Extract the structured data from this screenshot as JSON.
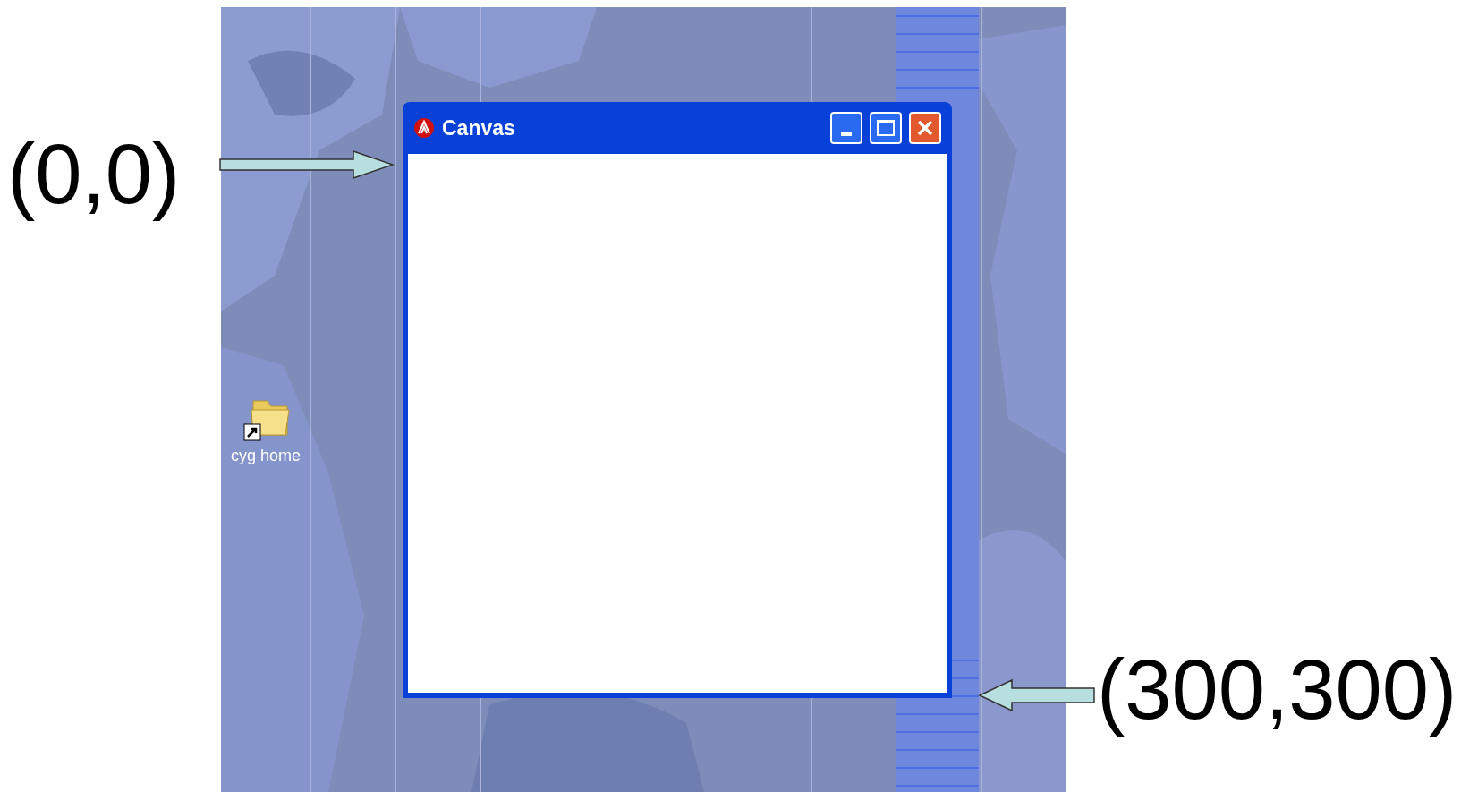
{
  "annotations": [
    {
      "text": "(0,0)"
    },
    {
      "text": "(300,300)"
    }
  ],
  "desktop": {
    "icons": [
      {
        "label": "cyg home"
      }
    ]
  },
  "window": {
    "title": "Canvas"
  }
}
